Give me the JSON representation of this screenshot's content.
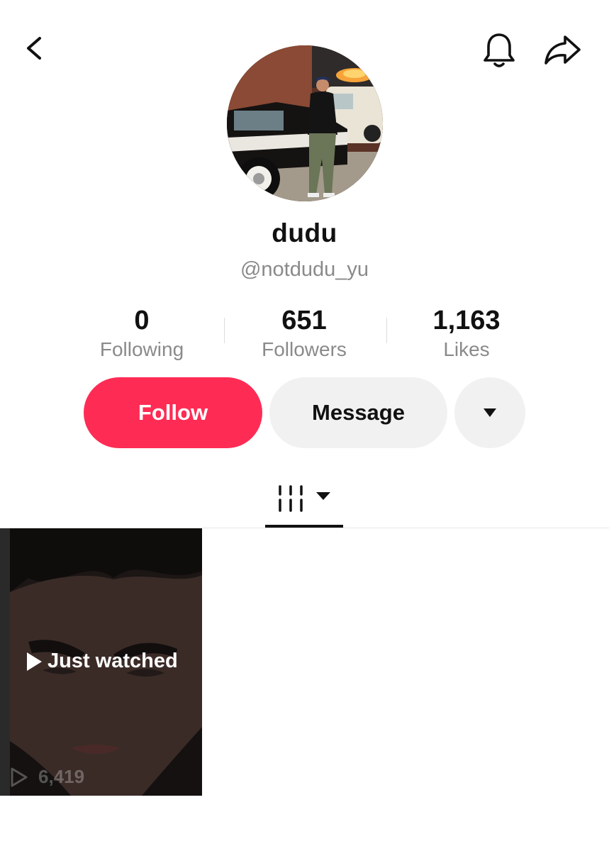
{
  "header": {
    "back_icon": "chevron-left-icon",
    "notification_icon": "bell-icon",
    "share_icon": "share-arrow-icon"
  },
  "profile": {
    "display_name": "dudu",
    "username": "@notdudu_yu"
  },
  "stats": {
    "following": {
      "value": "0",
      "label": "Following"
    },
    "followers": {
      "value": "651",
      "label": "Followers"
    },
    "likes": {
      "value": "1,163",
      "label": "Likes"
    }
  },
  "actions": {
    "follow_label": "Follow",
    "message_label": "Message",
    "more_icon": "caret-down-icon"
  },
  "tabs": {
    "videos_icon": "video-grid-icon",
    "dropdown_icon": "caret-down-icon"
  },
  "videos": [
    {
      "overlay_label": "Just watched",
      "views": "6,419"
    }
  ],
  "colors": {
    "follow_button": "#fe2c55",
    "secondary_button": "#f1f1f2",
    "muted_text": "#8a8a8a"
  }
}
